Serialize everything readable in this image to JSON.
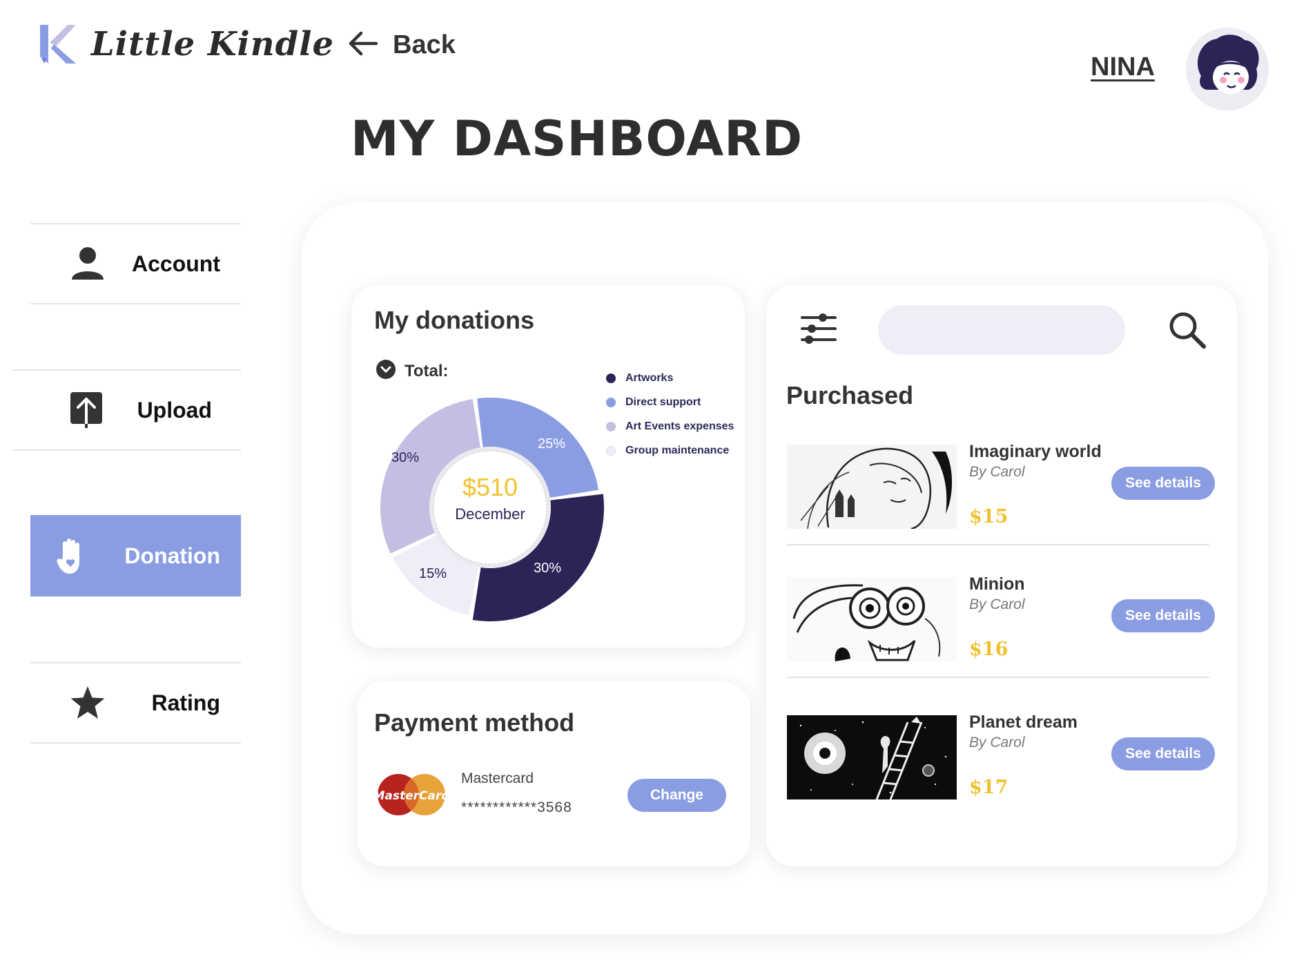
{
  "app": {
    "name": "Little Kindle"
  },
  "header": {
    "back_label": "Back",
    "page_title": "MY DASHBOARD",
    "user_name": "NINA"
  },
  "sidebar": {
    "items": [
      {
        "label": "Account",
        "icon": "person-icon"
      },
      {
        "label": "Upload",
        "icon": "upload-icon"
      },
      {
        "label": "Donation",
        "icon": "hand-heart-icon",
        "active": true
      },
      {
        "label": "Rating",
        "icon": "star-icon"
      }
    ]
  },
  "donations": {
    "title": "My donations",
    "total_label": "Total:",
    "amount": "$510",
    "month": "December",
    "segments": [
      {
        "name": "Artworks",
        "label": "30%",
        "value": 30,
        "color": "#2b2457"
      },
      {
        "name": "Direct support",
        "label": "25%",
        "value": 25,
        "color": "#8a9de3"
      },
      {
        "name": "Art Events expenses",
        "label": "30%",
        "value": 30,
        "color": "#c2bfe3"
      },
      {
        "name": "Group maintenance",
        "label": "15%",
        "value": 15,
        "color": "#eeedf8"
      }
    ]
  },
  "payment": {
    "title": "Payment method",
    "brand_logo_text": "MasterCard",
    "card_name": "Mastercard",
    "card_number": "************3568",
    "change_label": "Change"
  },
  "purchased": {
    "search_placeholder": "",
    "title": "Purchased",
    "items": [
      {
        "title": "Imaginary world",
        "author": "By Carol",
        "price": "$15",
        "button": "See details"
      },
      {
        "title": "Minion",
        "author": "By Carol",
        "price": "$16",
        "button": "See details"
      },
      {
        "title": "Planet dream",
        "author": "By Carol",
        "price": "$17",
        "button": "See details"
      }
    ]
  },
  "colors": {
    "accent": "#8a9de3",
    "dark": "#2b2457",
    "price": "#f0c233",
    "amount": "#f0c233"
  }
}
